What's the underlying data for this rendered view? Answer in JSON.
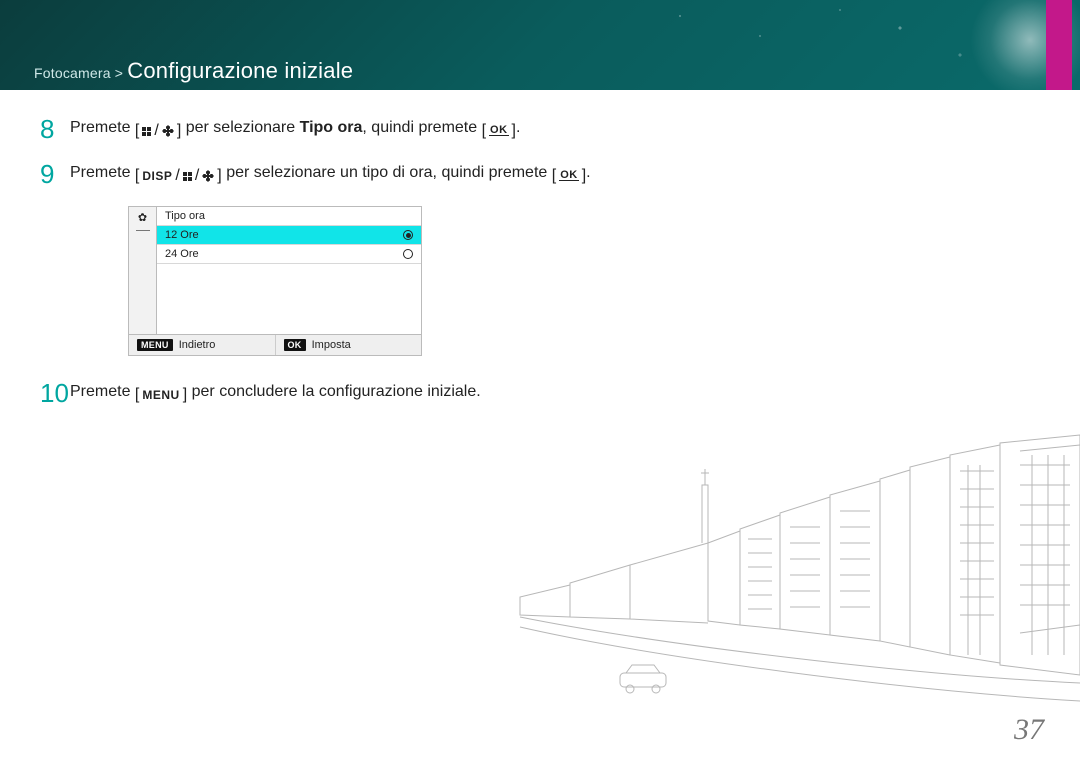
{
  "breadcrumb": {
    "root": "Fotocamera",
    "sep": " > ",
    "title": "Configurazione iniziale"
  },
  "step8": {
    "num": "8",
    "t1": "Premete ",
    "t2": " per selezionare ",
    "bold": "Tipo ora",
    "t3": ", quindi premete ",
    "t4": "."
  },
  "step9": {
    "num": "9",
    "t1": "Premete ",
    "t2": " per selezionare un tipo di ora, quindi premete ",
    "t3": "."
  },
  "cam": {
    "header": "Tipo ora",
    "opt1": "12 Ore",
    "opt2": "24 Ore",
    "back_key": "MENU",
    "back_label": "Indietro",
    "set_key": "OK",
    "set_label": "Imposta"
  },
  "step10": {
    "num": "10",
    "t1": "Premete ",
    "t2": " per concludere la configurazione iniziale."
  },
  "buttons": {
    "disp": "DISP",
    "menu": "MENU",
    "ok": "OK"
  },
  "page_number": "37"
}
